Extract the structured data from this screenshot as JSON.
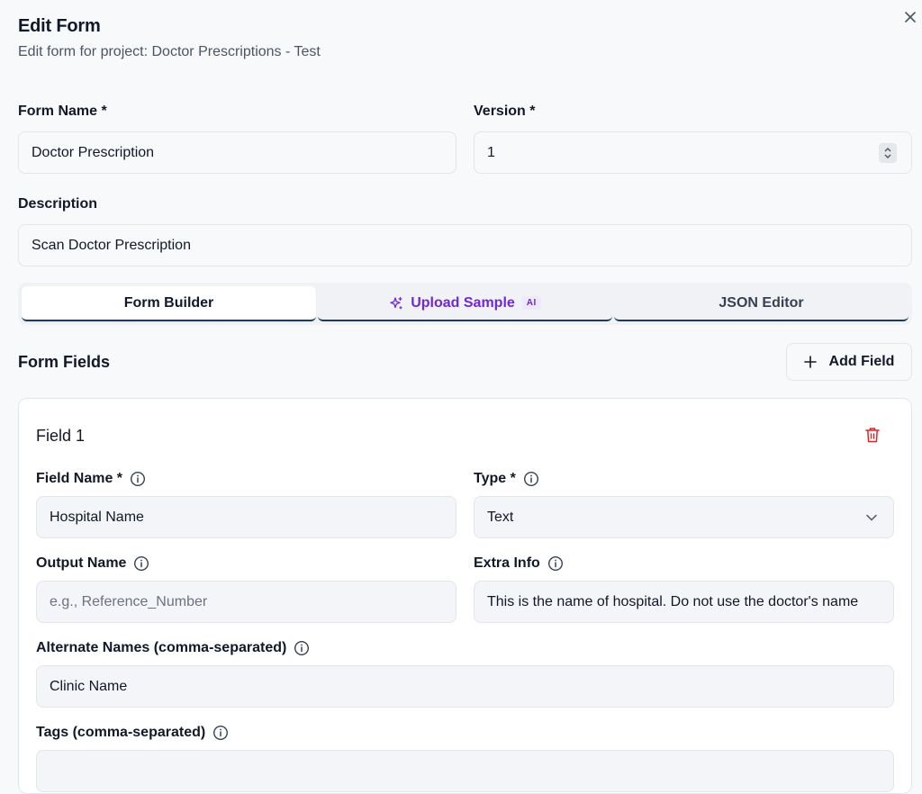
{
  "dialog": {
    "title": "Edit Form",
    "subtitle": "Edit form for project: Doctor Prescriptions - Test"
  },
  "form": {
    "name_label": "Form Name *",
    "name_value": "Doctor Prescription",
    "version_label": "Version *",
    "version_value": "1",
    "description_label": "Description",
    "description_value": "Scan Doctor Prescription"
  },
  "tabs": [
    {
      "label": "Form Builder",
      "active": true
    },
    {
      "label": "Upload Sample",
      "badge": "AI",
      "active": false
    },
    {
      "label": "JSON Editor",
      "active": false
    }
  ],
  "fields_section": {
    "title": "Form Fields",
    "add_label": "Add Field"
  },
  "field": {
    "title": "Field 1",
    "field_name_label": "Field Name *",
    "field_name_value": "Hospital Name",
    "type_label": "Type *",
    "type_value": "Text",
    "output_name_label": "Output Name",
    "output_name_placeholder": "e.g., Reference_Number",
    "extra_info_label": "Extra Info",
    "extra_info_value": "This is the name of hospital. Do not use the doctor's name",
    "alternate_names_label": "Alternate Names (comma-separated)",
    "alternate_names_value": "Clinic Name",
    "tags_label": "Tags (comma-separated)"
  },
  "colors": {
    "accent_purple": "#6d28d9",
    "danger": "#dc2626",
    "tab_underline": "#1e3a5f"
  }
}
